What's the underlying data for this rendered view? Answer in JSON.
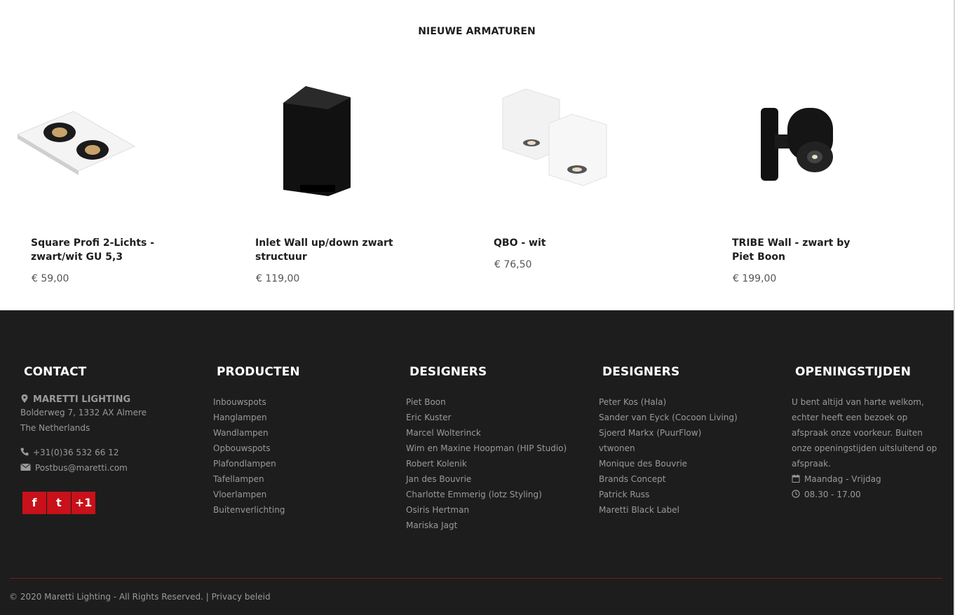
{
  "products": {
    "title": "NIEUWE ARMATUREN",
    "items": [
      {
        "name": "Square Profi 2-Lichts - zwart/wit GU 5,3",
        "price": "€ 59,00"
      },
      {
        "name": "Inlet Wall up/down zwart structuur",
        "price": "€ 119,00"
      },
      {
        "name": "QBO - wit",
        "price": "€ 76,50"
      },
      {
        "name": "TRIBE Wall - zwart by Piet Boon",
        "price": "€ 199,00"
      }
    ]
  },
  "footer": {
    "contact": {
      "title": "CONTACT",
      "company": "MARETTI LIGHTING",
      "address": "Bolderweg 7, 1332 AX Almere",
      "country": "The Netherlands",
      "phone": "+31(0)36 532 66 12",
      "email": "Postbus@maretti.com",
      "social": [
        "f",
        "t",
        "+1"
      ]
    },
    "producten": {
      "title": "PRODUCTEN",
      "items": [
        "Inbouwspots",
        "Hanglampen",
        "Wandlampen",
        "Opbouwspots",
        "Plafondlampen",
        "Tafellampen",
        "Vloerlampen",
        "Buitenverlichting"
      ]
    },
    "designers1": {
      "title": "DESIGNERS",
      "items": [
        "Piet Boon",
        "Eric Kuster",
        "Marcel Wolterinck",
        "Wim en Maxine Hoopman (HIP Studio)",
        "Robert Kolenik",
        "Jan des Bouvrie",
        "Charlotte Emmerig (lotz Styling)",
        "Osiris Hertman",
        "Mariska Jagt"
      ]
    },
    "designers2": {
      "title": "DESIGNERS",
      "items": [
        "Peter Kos (Hala)",
        "Sander van Eyck (Cocoon Living)",
        "Sjoerd Markx (PuurFlow)",
        "vtwonen",
        "Monique des Bouvrie",
        "Brands Concept",
        "Patrick Russ",
        "Maretti Black Label"
      ]
    },
    "opening": {
      "title": "OPENINGSTIJDEN",
      "text": "U bent altijd van harte welkom, echter heeft een bezoek op afspraak onze voorkeur. Buiten onze openingstijden uitsluitend op afspraak.",
      "days": "Maandag - Vrijdag",
      "hours": "08.30 - 17.00"
    },
    "copyright": "© 2020 Maretti Lighting - All Rights Reserved.",
    "privacy": "Privacy beleid"
  },
  "colors": {
    "accent": "#c8111a",
    "footer_bg": "#1d1d1d"
  }
}
